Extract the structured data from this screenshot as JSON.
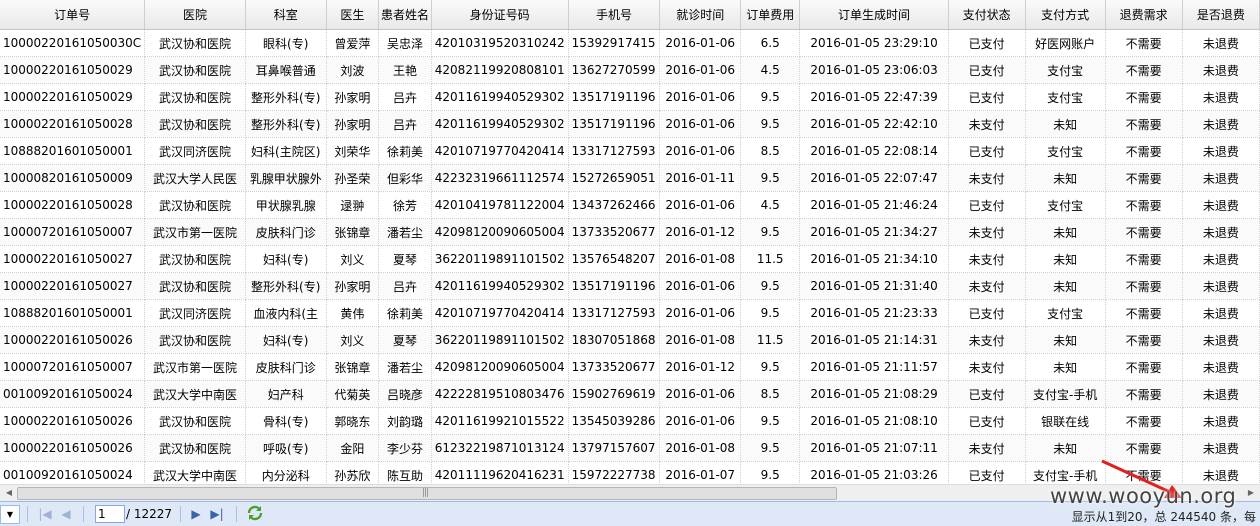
{
  "columns": [
    "订单号",
    "医院",
    "科室",
    "医生",
    "患者姓名",
    "身份证号码",
    "手机号",
    "就诊时间",
    "订单费用",
    "订单生成时间",
    "支付状态",
    "支付方式",
    "退费需求",
    "是否退费"
  ],
  "rows": [
    [
      "10000220161050030C",
      "武汉协和医院",
      "眼科(专)",
      "曾爱萍",
      "吴忠泽",
      "42010319520310242",
      "15392917415",
      "2016-01-06",
      "6.5",
      "2016-01-05 23:29:10",
      "已支付",
      "好医网账户",
      "不需要",
      "未退费"
    ],
    [
      "10000220161050029",
      "武汉协和医院",
      "耳鼻喉普通",
      "刘波",
      "王艳",
      "42082119920808101",
      "13627270599",
      "2016-01-06",
      "4.5",
      "2016-01-05 23:06:03",
      "已支付",
      "支付宝",
      "不需要",
      "未退费"
    ],
    [
      "10000220161050029",
      "武汉协和医院",
      "整形外科(专)",
      "孙家明",
      "吕卉",
      "42011619940529302",
      "13517191196",
      "2016-01-06",
      "9.5",
      "2016-01-05 22:47:39",
      "已支付",
      "支付宝",
      "不需要",
      "未退费"
    ],
    [
      "10000220161050028",
      "武汉协和医院",
      "整形外科(专)",
      "孙家明",
      "吕卉",
      "42011619940529302",
      "13517191196",
      "2016-01-06",
      "9.5",
      "2016-01-05 22:42:10",
      "未支付",
      "未知",
      "不需要",
      "未退费"
    ],
    [
      "10888201601050001",
      "武汉同济医院",
      "妇科(主院区)",
      "刘荣华",
      "徐莉美",
      "42010719770420414",
      "13317127593",
      "2016-01-06",
      "8.5",
      "2016-01-05 22:08:14",
      "已支付",
      "支付宝",
      "不需要",
      "未退费"
    ],
    [
      "10000820161050009",
      "武汉大学人民医",
      "乳腺甲状腺外",
      "孙圣荣",
      "但彩华",
      "42232319661112574",
      "15272659051",
      "2016-01-11",
      "9.5",
      "2016-01-05 22:07:47",
      "未支付",
      "未知",
      "不需要",
      "未退费"
    ],
    [
      "10000220161050028",
      "武汉协和医院",
      "甲状腺乳腺",
      "逯翀",
      "徐芳",
      "42010419781122004",
      "13437262466",
      "2016-01-06",
      "4.5",
      "2016-01-05 21:46:24",
      "已支付",
      "支付宝",
      "不需要",
      "未退费"
    ],
    [
      "10000720161050007",
      "武汉市第一医院",
      "皮肤科门诊",
      "张锦章",
      "潘若尘",
      "42098120090605004",
      "13733520677",
      "2016-01-12",
      "9.5",
      "2016-01-05 21:34:27",
      "未支付",
      "未知",
      "不需要",
      "未退费"
    ],
    [
      "10000220161050027",
      "武汉协和医院",
      "妇科(专)",
      "刘义",
      "夏琴",
      "36220119891101502",
      "13576548207",
      "2016-01-08",
      "11.5",
      "2016-01-05 21:34:10",
      "未支付",
      "未知",
      "不需要",
      "未退费"
    ],
    [
      "10000220161050027",
      "武汉协和医院",
      "整形外科(专)",
      "孙家明",
      "吕卉",
      "42011619940529302",
      "13517191196",
      "2016-01-06",
      "9.5",
      "2016-01-05 21:31:40",
      "未支付",
      "未知",
      "不需要",
      "未退费"
    ],
    [
      "10888201601050001",
      "武汉同济医院",
      "血液内科(主",
      "黄伟",
      "徐莉美",
      "42010719770420414",
      "13317127593",
      "2016-01-06",
      "9.5",
      "2016-01-05 21:23:33",
      "已支付",
      "支付宝",
      "不需要",
      "未退费"
    ],
    [
      "10000220161050026",
      "武汉协和医院",
      "妇科(专)",
      "刘义",
      "夏琴",
      "36220119891101502",
      "18307051868",
      "2016-01-08",
      "11.5",
      "2016-01-05 21:14:31",
      "未支付",
      "未知",
      "不需要",
      "未退费"
    ],
    [
      "10000720161050007",
      "武汉市第一医院",
      "皮肤科门诊",
      "张锦章",
      "潘若尘",
      "42098120090605004",
      "13733520677",
      "2016-01-12",
      "9.5",
      "2016-01-05 21:11:57",
      "未支付",
      "未知",
      "不需要",
      "未退费"
    ],
    [
      "00100920161050024",
      "武汉大学中南医",
      "妇产科",
      "代菊英",
      "吕晓彦",
      "42222819510803476",
      "15902769619",
      "2016-01-06",
      "8.5",
      "2016-01-05 21:08:29",
      "已支付",
      "支付宝-手机",
      "不需要",
      "未退费"
    ],
    [
      "10000220161050026",
      "武汉协和医院",
      "骨科(专)",
      "郭晓东",
      "刘韵璐",
      "42011619921015522",
      "13545039286",
      "2016-01-06",
      "9.5",
      "2016-01-05 21:08:10",
      "已支付",
      "银联在线",
      "不需要",
      "未退费"
    ],
    [
      "10000220161050026",
      "武汉协和医院",
      "呼吸(专)",
      "金阳",
      "李少芬",
      "61232219871013124",
      "13797157607",
      "2016-01-08",
      "9.5",
      "2016-01-05 21:07:11",
      "未支付",
      "未知",
      "不需要",
      "未退费"
    ],
    [
      "00100920161050024",
      "武汉大学中南医",
      "内分泌科",
      "孙苏欣",
      "陈互助",
      "42011119620416231",
      "15972227738",
      "2016-01-07",
      "9.5",
      "2016-01-05 21:03:26",
      "已支付",
      "支付宝-手机",
      "不需要",
      "未退费"
    ]
  ],
  "pager": {
    "page_value": "1",
    "total_pages": "/ 12227",
    "info": "显示从1到20，总 244540 条，每"
  },
  "watermark": "www.wooyun.org",
  "colors": {
    "pager_bg": "#dfe8f6",
    "arrow": "#e02020"
  },
  "icons": [
    "dropdown-arrow-icon",
    "first-page-icon",
    "prev-page-icon",
    "next-page-icon",
    "last-page-icon",
    "refresh-icon"
  ]
}
